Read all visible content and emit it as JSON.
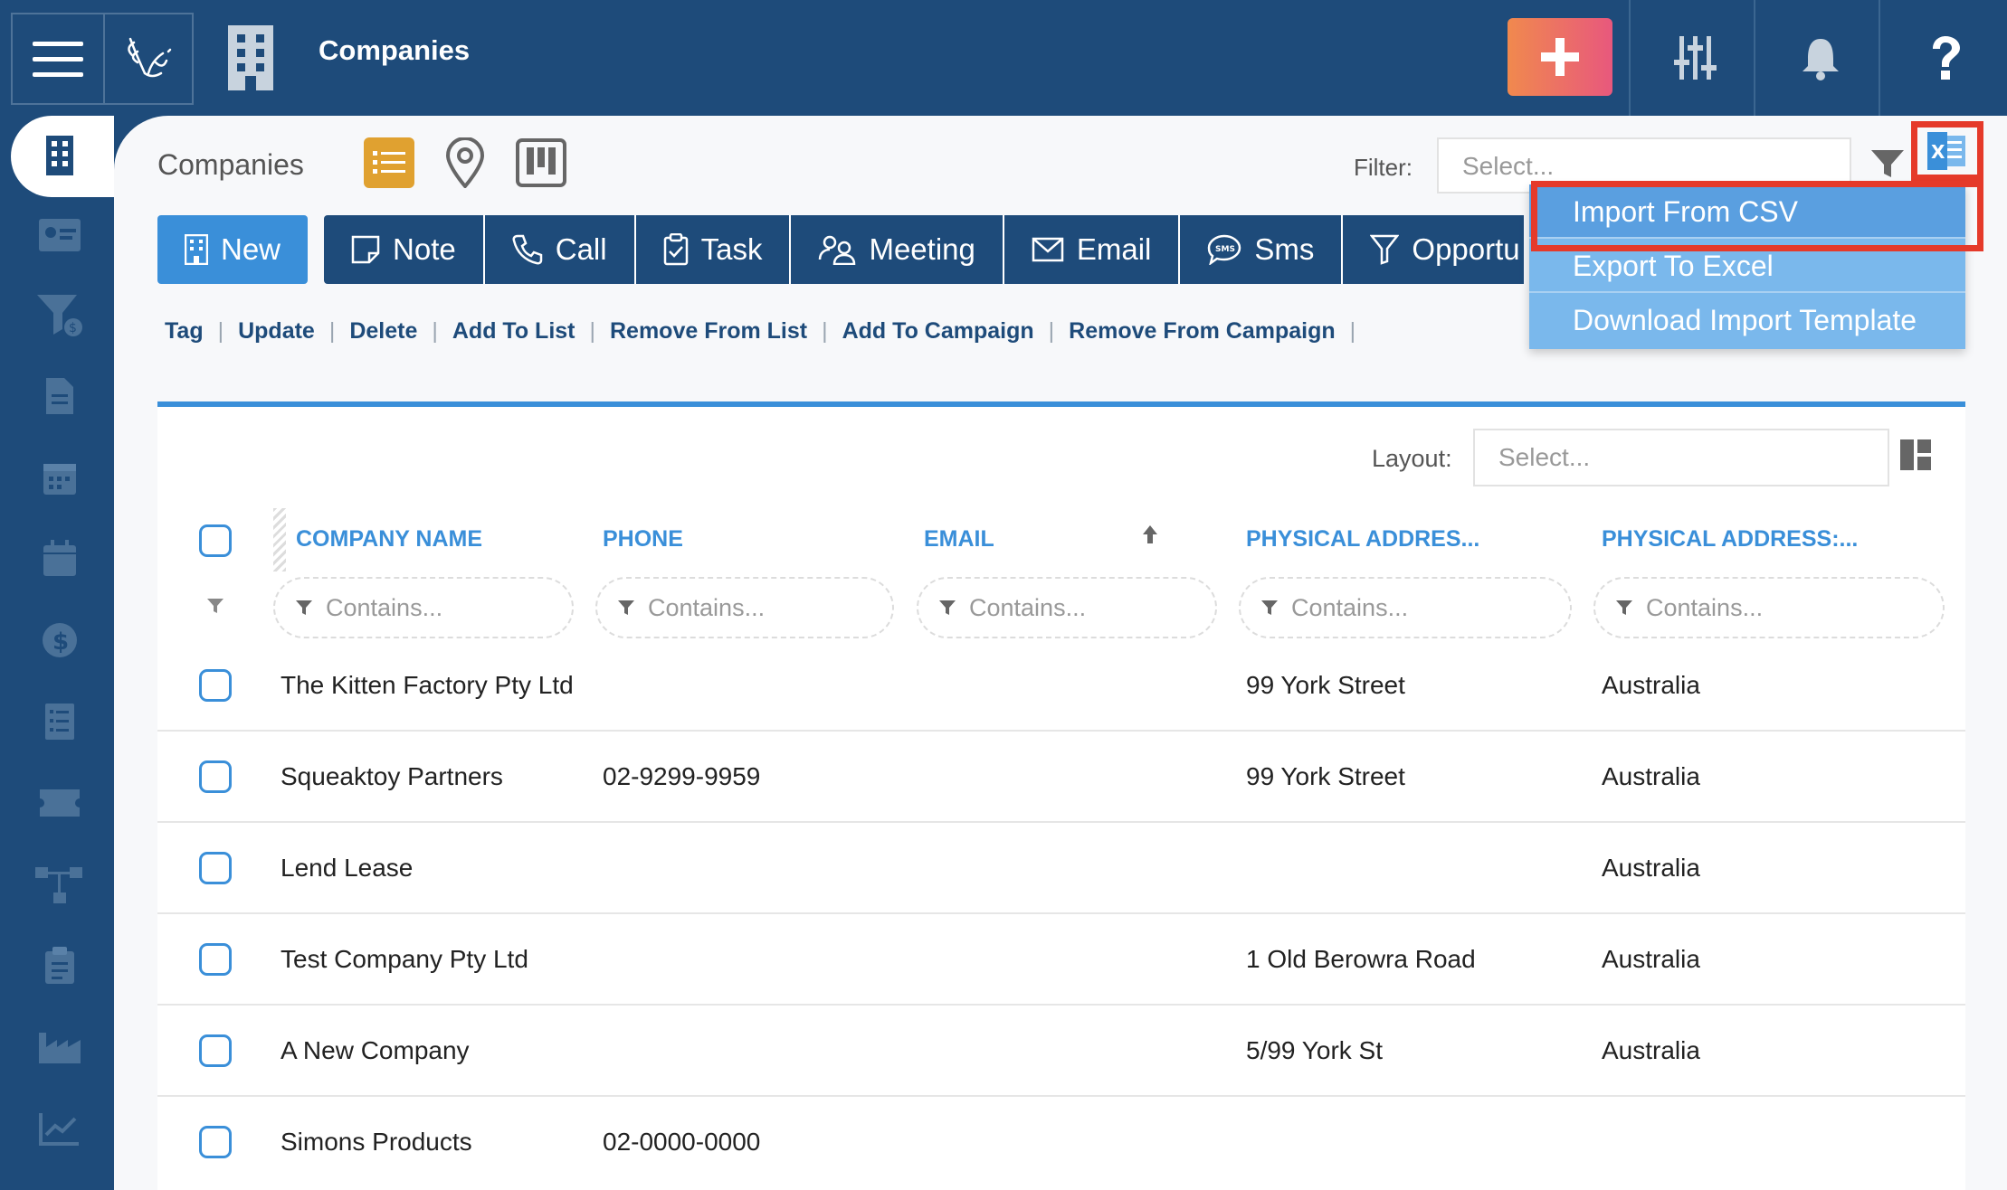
{
  "header": {
    "title": "Companies"
  },
  "toolbar": {
    "subtitle": "Companies",
    "filter_label": "Filter:",
    "filter_placeholder": "Select..."
  },
  "actions": [
    {
      "label": "New"
    },
    {
      "label": "Note"
    },
    {
      "label": "Call"
    },
    {
      "label": "Task"
    },
    {
      "label": "Meeting"
    },
    {
      "label": "Email"
    },
    {
      "label": "Sms"
    },
    {
      "label": "Opportu"
    }
  ],
  "links": [
    "Tag",
    "Update",
    "Delete",
    "Add To List",
    "Remove From List",
    "Add To Campaign",
    "Remove From Campaign"
  ],
  "dropdown": {
    "items": [
      "Import From CSV",
      "Export To Excel",
      "Download Import Template"
    ]
  },
  "grid": {
    "layout_label": "Layout:",
    "layout_placeholder": "Select...",
    "columns": [
      "COMPANY NAME",
      "PHONE",
      "EMAIL",
      "PHYSICAL ADDRES...",
      "PHYSICAL ADDRESS:..."
    ],
    "filter_placeholder": "Contains...",
    "rows": [
      {
        "name": "The Kitten Factory Pty Ltd",
        "phone": "",
        "email": "",
        "address": "99 York Street",
        "country": "Australia"
      },
      {
        "name": "Squeaktoy Partners",
        "phone": "02-9299-9959",
        "email": "",
        "address": "99 York Street",
        "country": "Australia"
      },
      {
        "name": "Lend Lease",
        "phone": "",
        "email": "",
        "address": "",
        "country": "Australia"
      },
      {
        "name": "Test Company Pty Ltd",
        "phone": "",
        "email": "",
        "address": "1 Old Berowra Road",
        "country": "Australia"
      },
      {
        "name": "A New Company",
        "phone": "",
        "email": "",
        "address": "5/99 York St",
        "country": "Australia"
      },
      {
        "name": "Simons Products",
        "phone": "02-0000-0000",
        "email": "",
        "address": "",
        "country": ""
      }
    ]
  },
  "colors": {
    "primary": "#1e4b7a",
    "accent": "#3a8fd9",
    "dropdown": "#7ab8ec",
    "highlight": "#e53a2a",
    "add_button_gradient": [
      "#f0894e",
      "#e8587d"
    ],
    "list_view_active": "#e0a130"
  },
  "icons": {
    "top": [
      "hamburger-menu-icon",
      "leaf-logo-icon",
      "building-icon",
      "plus-icon",
      "sliders-icon",
      "bell-icon",
      "help-icon"
    ],
    "sidebar": [
      "companies-icon",
      "contacts-card-icon",
      "funnel-dollar-icon",
      "document-icon",
      "calendar-icon",
      "calendar-alt-icon",
      "dollar-icon",
      "checklist-icon",
      "ticket-icon",
      "workflow-icon",
      "clipboard-icon",
      "factory-icon",
      "chart-icon"
    ],
    "views": [
      "list-view-icon",
      "map-pin-icon",
      "kanban-icon"
    ]
  }
}
